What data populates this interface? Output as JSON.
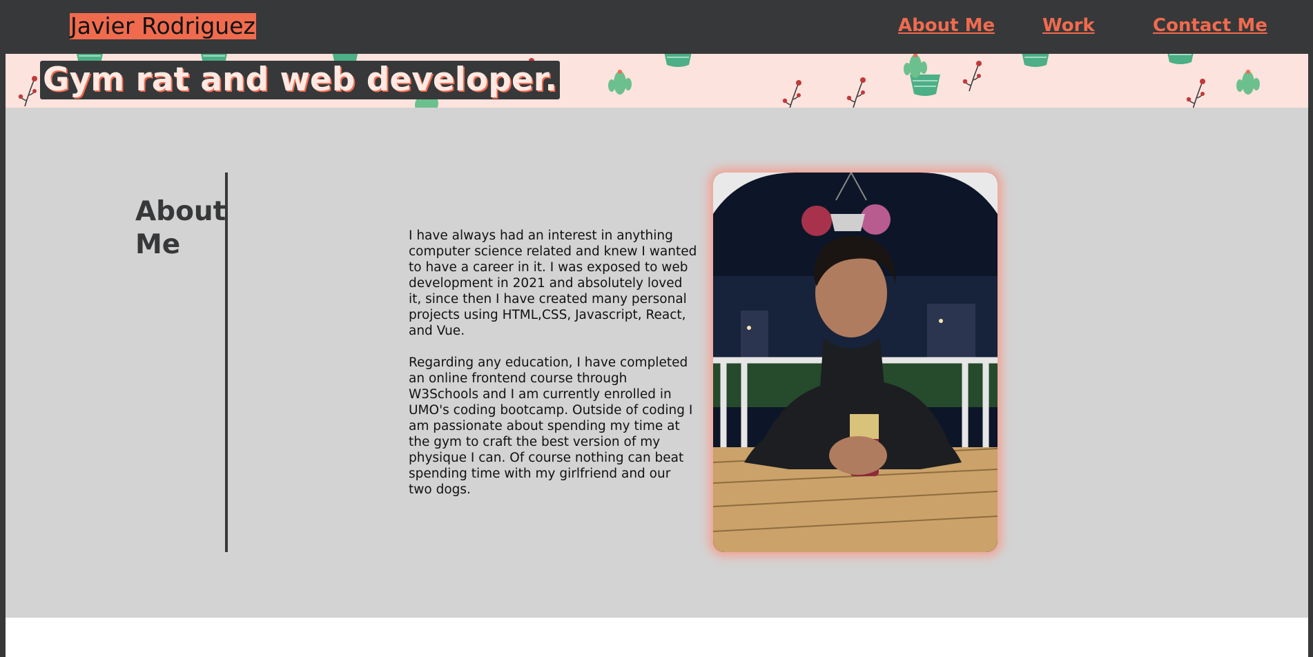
{
  "header": {
    "site_name": "Javier Rodriguez",
    "nav": {
      "about": "About Me",
      "work": "Work",
      "contact": "Contact Me"
    }
  },
  "banner": {
    "tagline": "Gym rat and web developer."
  },
  "about": {
    "heading": "About Me",
    "paragraph_1": "I have always had an interest in anything computer science related and knew I wanted to have a career in it. I was exposed to web development in 2021 and absolutely loved it, since then I have created many personal projects using HTML,CSS, Javascript, React, and Vue.",
    "paragraph_2": "Regarding any education, I have completed an online frontend course through W3Schools and I am currently enrolled in UMO's coding bootcamp. Outside of coding I am passionate about spending my time at the gym to craft the best version of my physique I can. Of course nothing can beat spending time with my girlfriend and our two dogs."
  },
  "colors": {
    "dark": "#37383a",
    "accent": "#f06b4e",
    "banner_bg": "#fde3dd",
    "section_bg": "#d3d3d3"
  },
  "icons": [
    "cactus-pot-icon",
    "rose-branch-icon"
  ]
}
